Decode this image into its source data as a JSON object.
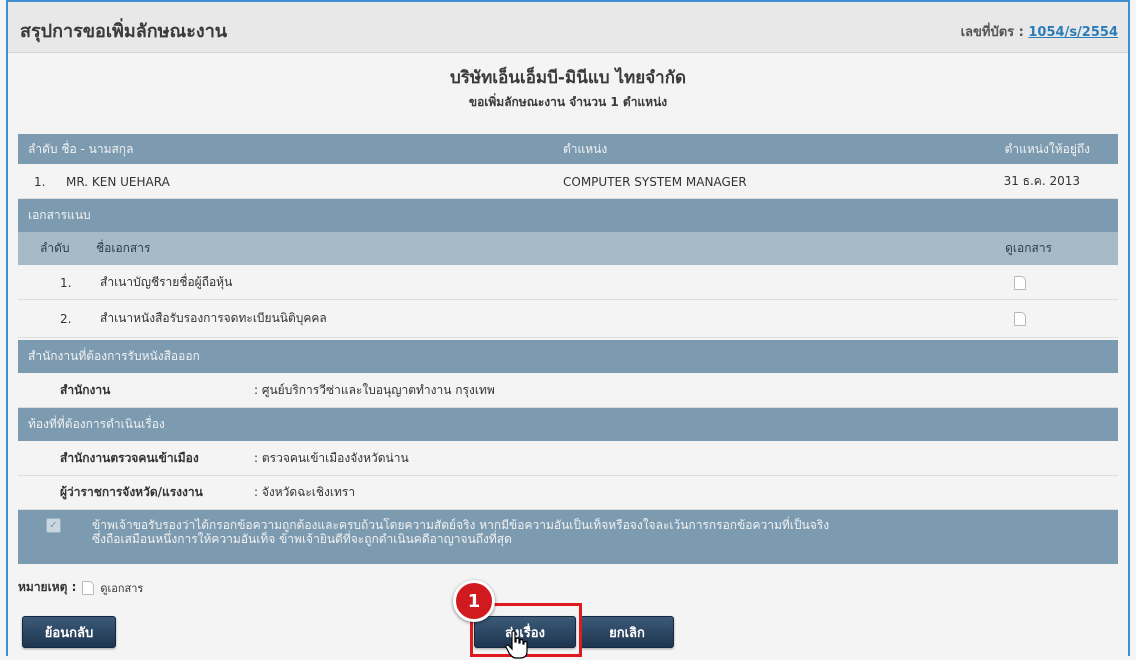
{
  "header": {
    "title": "สรุปการขอเพิ่มลักษณะงาน",
    "cert_label": "เลขที่บัตร : ",
    "cert_number": "1054/s/2554"
  },
  "company": {
    "name": "บริษัทเอ็นเอ็มบี-มินีแบ ไทยจำกัด",
    "subtitle": "ขอเพิ่มลักษณะงาน จำนวน 1 ตำแหน่ง"
  },
  "positions": {
    "headers": {
      "no_name": "ลำดับ  ชื่อ - นามสกุล",
      "position": "ตำแหน่ง",
      "until": "ตำแหน่งให้อยู่ถึง"
    },
    "rows": [
      {
        "no": "1.",
        "name": "MR. KEN UEHARA",
        "position": "COMPUTER SYSTEM MANAGER",
        "until": "31 ธ.ค. 2013"
      }
    ]
  },
  "attachments": {
    "title": "เอกสารแนบ",
    "headers": {
      "no": "ลำดับ",
      "name": "ชื่อเอกสาร",
      "view": "ดูเอกสาร"
    },
    "rows": [
      {
        "no": "1.",
        "name": "สำเนาบัญชีรายชื่อผู้ถือหุ้น",
        "icon": "document-icon"
      },
      {
        "no": "2.",
        "name": "สำเนาหนังสือรับรองการจดทะเบียนนิติบุคคล",
        "icon": "document-icon"
      }
    ]
  },
  "office": {
    "title": "สำนักงานที่ต้องการรับหนังสือออก",
    "label": "สำนักงาน",
    "value": ":  ศูนย์บริการวีซ่าและใบอนุญาตทำงาน กรุงเทพ"
  },
  "location": {
    "title": "ท้องที่ที่ต้องการดำเนินเรื่อง",
    "immigration_label": "สำนักงานตรวจคนเข้าเมือง",
    "immigration_value": ":  ตรวจคนเข้าเมืองจังหวัดน่าน",
    "governor_label": "ผู้ว่าราชการจังหวัด/แรงงาน",
    "governor_value": ":  จังหวัดฉะเชิงเทรา"
  },
  "declaration": {
    "line1": "ข้าพเจ้าขอรับรองว่าได้กรอกข้อความถูกต้องและครบถ้วนโดยความสัตย์จริง หากมีข้อความอันเป็นเท็จหรือจงใจละเว้นการกรอกข้อความที่เป็นจริง",
    "line2": "ซึ่งถือเสมือนหนึ่งการให้ความอันเท็จ ข้าพเจ้ายินดีที่จะถูกดำเนินคดีอาญาจนถึงที่สุด",
    "checked": true
  },
  "note": {
    "label": "หมายเหตุ :",
    "icon_text": "ดูเอกสาร"
  },
  "buttons": {
    "back": "ย้อนกลับ",
    "submit": "ส่งเรื่อง",
    "cancel": "ยกเลิก"
  },
  "annotation": {
    "step": "1"
  },
  "colors": {
    "band": "#7c9bb1",
    "subband": "#a6bac8",
    "button": "#1e3550",
    "highlight": "#e0191e",
    "link": "#2a7db8"
  }
}
